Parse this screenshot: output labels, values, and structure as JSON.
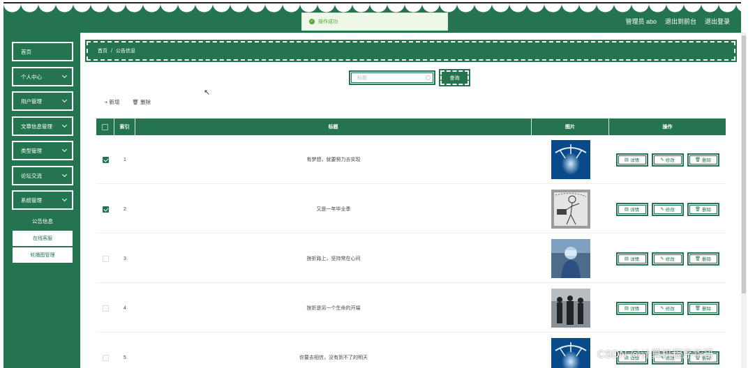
{
  "header": {
    "user_label": "管理员 abo",
    "back_label": "退出到前台",
    "logout_label": "退出登录"
  },
  "toast": {
    "message": "操作成功"
  },
  "sidebar": {
    "items": [
      {
        "label": "首页"
      },
      {
        "label": "个人中心"
      },
      {
        "label": "用户管理"
      },
      {
        "label": "文章信息管理"
      },
      {
        "label": "类型管理"
      },
      {
        "label": "论坛交流"
      },
      {
        "label": "系统管理"
      }
    ],
    "submenu_title": "公告信息",
    "submenu": [
      {
        "label": "在线客服"
      },
      {
        "label": "轮播图管理"
      }
    ]
  },
  "breadcrumb": {
    "home": "首页",
    "separator": "/",
    "current": "公告信息"
  },
  "search": {
    "placeholder": "标题",
    "button_label": "查询"
  },
  "toolbar": {
    "add_label": "+ 新增",
    "delete_label": "删除"
  },
  "table": {
    "columns": [
      "索引",
      "标题",
      "图片",
      "操作"
    ],
    "rows": [
      {
        "index": "1",
        "title": "有梦想，就要努力去实现",
        "checked": true,
        "image": "blue-water-splash"
      },
      {
        "index": "2",
        "title": "又是一年毕业季",
        "checked": true,
        "image": "graduation-sketch"
      },
      {
        "index": "3",
        "title": "挫折路上，坚持常在心间",
        "checked": false,
        "image": "person-in-protective-suit"
      },
      {
        "index": "4",
        "title": "挫折是另一个生命的开端",
        "checked": false,
        "image": "people-in-dark-coats"
      },
      {
        "index": "5",
        "title": "你要去相信，没有到不了的明天",
        "checked": false,
        "image": "blue-water-splash"
      }
    ],
    "actions": {
      "detail": "详情",
      "edit": "修改",
      "delete": "删除"
    }
  },
  "watermark": "CSDN @计算机程序华哥",
  "colors": {
    "primary": "#24744f",
    "success": "#5aa832"
  }
}
